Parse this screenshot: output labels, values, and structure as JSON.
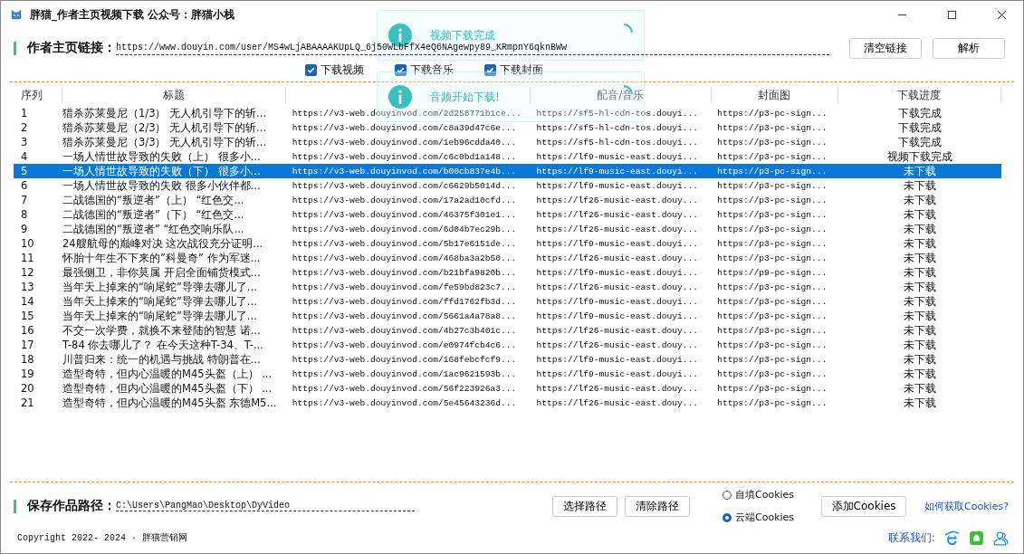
{
  "window": {
    "title": "胖猫_作者主页视频下载  公众号：胖猫小栈"
  },
  "link": {
    "label": "作者主页链接：",
    "value": "https://www.douyin.com/user/MS4wLjABAAAAKUpLQ_6j50WLbFfX4eQ6NAgewpy89_KRmpnY6qknBWw"
  },
  "link_buttons": [
    "清空链接",
    "解析"
  ],
  "options": [
    {
      "label": "下载视频",
      "checked": true
    },
    {
      "label": "下载音乐",
      "checked": true
    },
    {
      "label": "下载封面",
      "checked": true
    }
  ],
  "toasts": [
    {
      "message": "视频下载完成"
    },
    {
      "message": "音频开始下载!"
    }
  ],
  "table": {
    "columns": [
      {
        "label": "序列"
      },
      {
        "label": "标题"
      },
      {},
      {
        "label": "配音/音乐"
      },
      {
        "label": "封面图"
      },
      {
        "label": "下载进度"
      }
    ],
    "rows": [
      {
        "selected": false,
        "cells": [
          "1",
          "猎杀苏莱曼尼（1/3） 无人机引导下的斩...",
          "https://v3-web.douyinvod.com/2d258771b1ce...",
          "https://sf5-hl-cdn-tos.douyi...",
          "https://p3-pc-sign...",
          "下载完成"
        ]
      },
      {
        "selected": false,
        "cells": [
          "2",
          "猎杀苏莱曼尼（2/3） 无人机引导下的斩...",
          "https://v3-web.douyinvod.com/c8a39d47c6e...",
          "https://sf5-hl-cdn-tos.douyi...",
          "https://p3-pc-sign...",
          "下载完成"
        ]
      },
      {
        "selected": false,
        "cells": [
          "3",
          "猎杀苏莱曼尼（3/3） 无人机引导下的斩...",
          "https://v3-web.douyinvod.com/1eb96cdda40...",
          "https://sf5-hl-cdn-tos.douyi...",
          "https://p3-pc-sign...",
          "下载完成"
        ]
      },
      {
        "selected": false,
        "cells": [
          "4",
          "一场人情世故导致的失败（上） 很多小...",
          "https://v3-web.douyinvod.com/c6c0bd1a148...",
          "https://lf9-music-east.douyi...",
          "https://p3-pc-sign...",
          "视频下载完成"
        ]
      },
      {
        "selected": true,
        "cells": [
          "5",
          "一场人情世故导致的失败（下） 很多小...",
          "https://v3-web.douyinvod.com/b00cb837e4b...",
          "https://lf9-music-east.douyi...",
          "https://p3-pc-sign...",
          "未下载"
        ]
      },
      {
        "selected": false,
        "cells": [
          "6",
          "一场人情世故导致的失败 很多小伙伴都...",
          "https://v3-web.douyinvod.com/c6629b5014d...",
          "https://lf9-music-east.douyi...",
          "https://p3-pc-sign...",
          "未下载"
        ]
      },
      {
        "selected": false,
        "cells": [
          "7",
          "二战德国的“叛逆者”（上） “红色交...",
          "https://v3-web.douyinvod.com/17a2ad10cfd...",
          "https://lf26-music-east.douy...",
          "https://p3-pc-sign...",
          "未下载"
        ]
      },
      {
        "selected": false,
        "cells": [
          "8",
          "二战德国的“叛逆者”（下） “红色交...",
          "https://v3-web.douyinvod.com/46375f301e1...",
          "https://lf26-music-east.douy...",
          "https://p3-pc-sign...",
          "未下载"
        ]
      },
      {
        "selected": false,
        "cells": [
          "9",
          "二战德国的“叛逆者” “红色交响乐队...",
          "https://v3-web.douyinvod.com/6d04b7ec29b...",
          "https://lf26-music-east.douy...",
          "https://p3-pc-sign...",
          "未下载"
        ]
      },
      {
        "selected": false,
        "cells": [
          "10",
          "24艘航母的巅峰对决 这次战役充分证明...",
          "https://v3-web.douyinvod.com/5b17e6151de...",
          "https://lf9-music-east.douyi...",
          "https://p3-pc-sign...",
          "未下载"
        ]
      },
      {
        "selected": false,
        "cells": [
          "11",
          "怀胎十年生不下来的”科曼奇” 作为军迷...",
          "https://v3-web.douyinvod.com/468ba3a2b50...",
          "https://lf26-music-east.douy...",
          "https://p3-pc-sign...",
          "未下载"
        ]
      },
      {
        "selected": false,
        "cells": [
          "12",
          "最强侧卫，非你莫属 开启全面铺货模式...",
          "https://v3-web.douyinvod.com/b21bfa9820b...",
          "https://lf9-music-east.douyi...",
          "https://p9-pc-sign...",
          "未下载"
        ]
      },
      {
        "selected": false,
        "cells": [
          "13",
          "当年天上掉来的“响尾蛇”导弹去哪儿了...",
          "https://v3-web.douyinvod.com/fe59bd823c7...",
          "https://lf26-music-east.douy...",
          "https://p3-pc-sign...",
          "未下载"
        ]
      },
      {
        "selected": false,
        "cells": [
          "14",
          "当年天上掉来的“响尾蛇”导弹去哪儿了...",
          "https://v3-web.douyinvod.com/ffd1762fb3d...",
          "https://lf9-music-east.douyi...",
          "https://p3-pc-sign...",
          "未下载"
        ]
      },
      {
        "selected": false,
        "cells": [
          "15",
          "当年天上掉来的“响尾蛇”导弹去哪儿了...",
          "https://v3-web.douyinvod.com/5661a4a78a8...",
          "https://lf9-music-east.douyi...",
          "https://p3-pc-sign...",
          "未下载"
        ]
      },
      {
        "selected": false,
        "cells": [
          "16",
          "不交一次学费，就换不来登陆的智慧 诺...",
          "https://v3-web.douyinvod.com/4b27c3b401c...",
          "https://lf26-music-east.douy...",
          "https://p3-pc-sign...",
          "未下载"
        ]
      },
      {
        "selected": false,
        "cells": [
          "17",
          "T-84 你去哪儿了？ 在今天这种T-34、T-...",
          "https://v3-web.douyinvod.com/e0974fcb4c6...",
          "https://lf26-music-east.douy...",
          "https://p3-pc-sign...",
          "未下载"
        ]
      },
      {
        "selected": false,
        "cells": [
          "18",
          "川普归来：统一的机遇与挑战 特朗普在...",
          "https://v3-web.douyinvod.com/168febcfcf9...",
          "https://lf9-music-east.douyi...",
          "https://p3-pc-sign...",
          "未下载"
        ]
      },
      {
        "selected": false,
        "cells": [
          "19",
          "造型奇特，但内心温暖的M45头盔（上） ...",
          "https://v3-web.douyinvod.com/1ac9621593b...",
          "https://lf9-music-east.douyi...",
          "https://p3-pc-sign...",
          "未下载"
        ]
      },
      {
        "selected": false,
        "cells": [
          "20",
          "造型奇特，但内心温暖的M45头盔（下） ...",
          "https://v3-web.douyinvod.com/56f223926a3...",
          "https://lf26-music-east.douy...",
          "https://p3-pc-sign...",
          "未下载"
        ]
      },
      {
        "selected": false,
        "cells": [
          "21",
          "造型奇特，但内心温暖的M45头盔 东德M5...",
          "https://v3-web.douyinvod.com/5e45643236d...",
          "https://lf26-music-east.douy...",
          "https://p3-pc-sign...",
          "未下载"
        ]
      }
    ]
  },
  "save_path": {
    "label": "保存作品路径：",
    "value": "C:\\Users\\PangMao\\Desktop\\DyVideo"
  },
  "path_buttons": [
    "选择路径",
    "清除路径"
  ],
  "cookie_sources": [
    {
      "label": "自填Cookies",
      "selected": false
    },
    {
      "label": "云端Cookies",
      "selected": true
    }
  ],
  "add_cookies_button": "添加Cookies",
  "help_link": "如何获取Cookies?",
  "footer": {
    "copyright": "Copyright 2022- 2024  ·  胖猫营销网",
    "contact": "联系我们:"
  }
}
